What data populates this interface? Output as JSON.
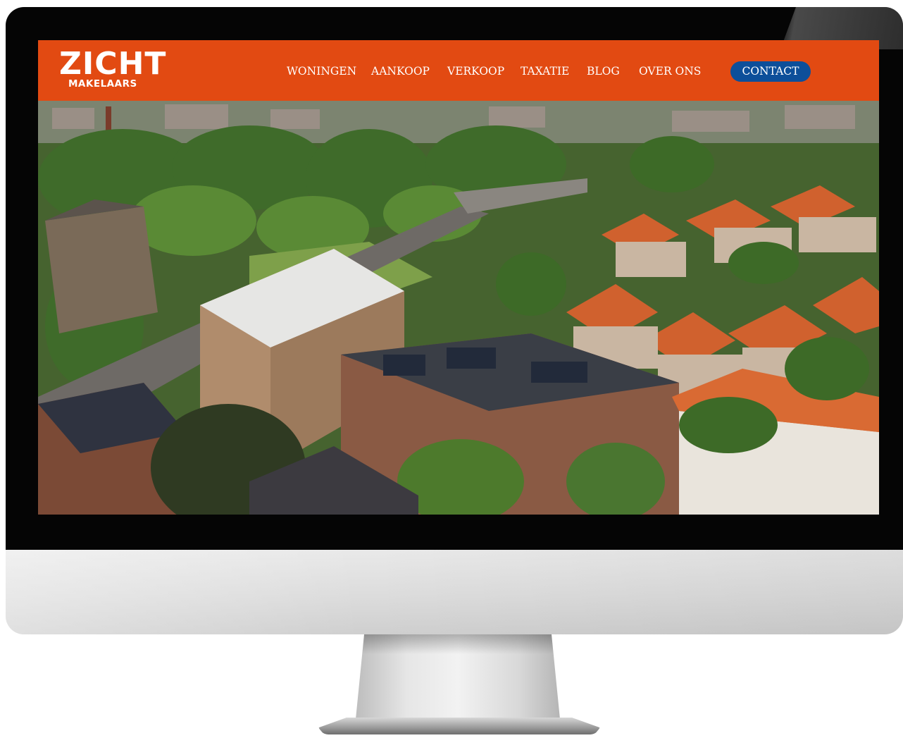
{
  "brand": {
    "logo_main": "ZICHT",
    "logo_sub": "MAKELAARS"
  },
  "nav": {
    "items": [
      {
        "label": "WONINGEN"
      },
      {
        "label": "AANKOOP"
      },
      {
        "label": "VERKOOP"
      },
      {
        "label": "TAXATIE"
      },
      {
        "label": "BLOG"
      },
      {
        "label": "OVER ONS"
      }
    ],
    "contact_label": "CONTACT"
  },
  "hero": {
    "image_alt": "aerial-neighborhood-photo"
  },
  "colors": {
    "header_bg": "#e24a12",
    "contact_bg": "#0d4f9a",
    "bezel": "#050505"
  }
}
